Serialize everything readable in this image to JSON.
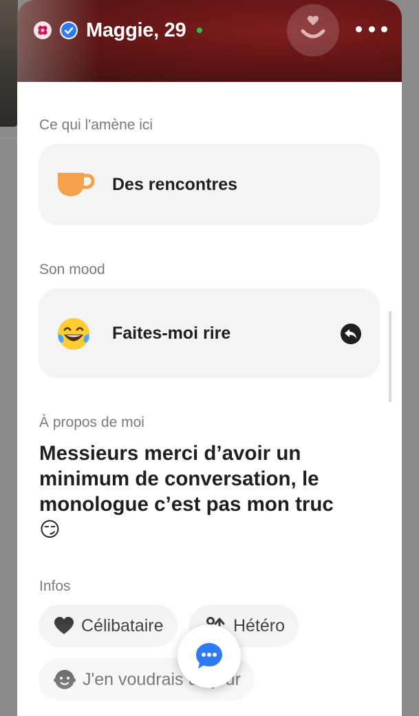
{
  "profile": {
    "name_age": "Maggie, 29",
    "online": true
  },
  "icons": {
    "flower": "flower-badge-icon",
    "verified": "verified-check-icon",
    "like": "smile-heart-icon",
    "more": "more-dots-icon",
    "intent": "coffee-cup-icon",
    "mood": "laughing-emoji-icon",
    "reply": "reply-arrow-icon",
    "about_emoji": "smirk-emoji-icon",
    "status": "heart-icon",
    "orientation": "orientation-icon",
    "children": "baby-icon",
    "chat": "chat-bubble-icon"
  },
  "sections": {
    "intent_label": "Ce qui l'amène ici",
    "intent_value": "Des rencontres",
    "mood_label": "Son mood",
    "mood_value": "Faites-moi rire",
    "about_label": "À propos de moi",
    "about_text": "Messieurs merci d’avoir un minimum de conversation, le monologue c’est pas mon truc",
    "about_emoji": "😏",
    "infos_label": "Infos"
  },
  "infos": {
    "status": "Célibataire",
    "orientation": "Hétéro",
    "children": "J'en voudrais un jour"
  },
  "colors": {
    "accent_blue": "#2f7bf5",
    "online_green": "#2fbf4a",
    "cup_orange": "#f5a04a"
  }
}
